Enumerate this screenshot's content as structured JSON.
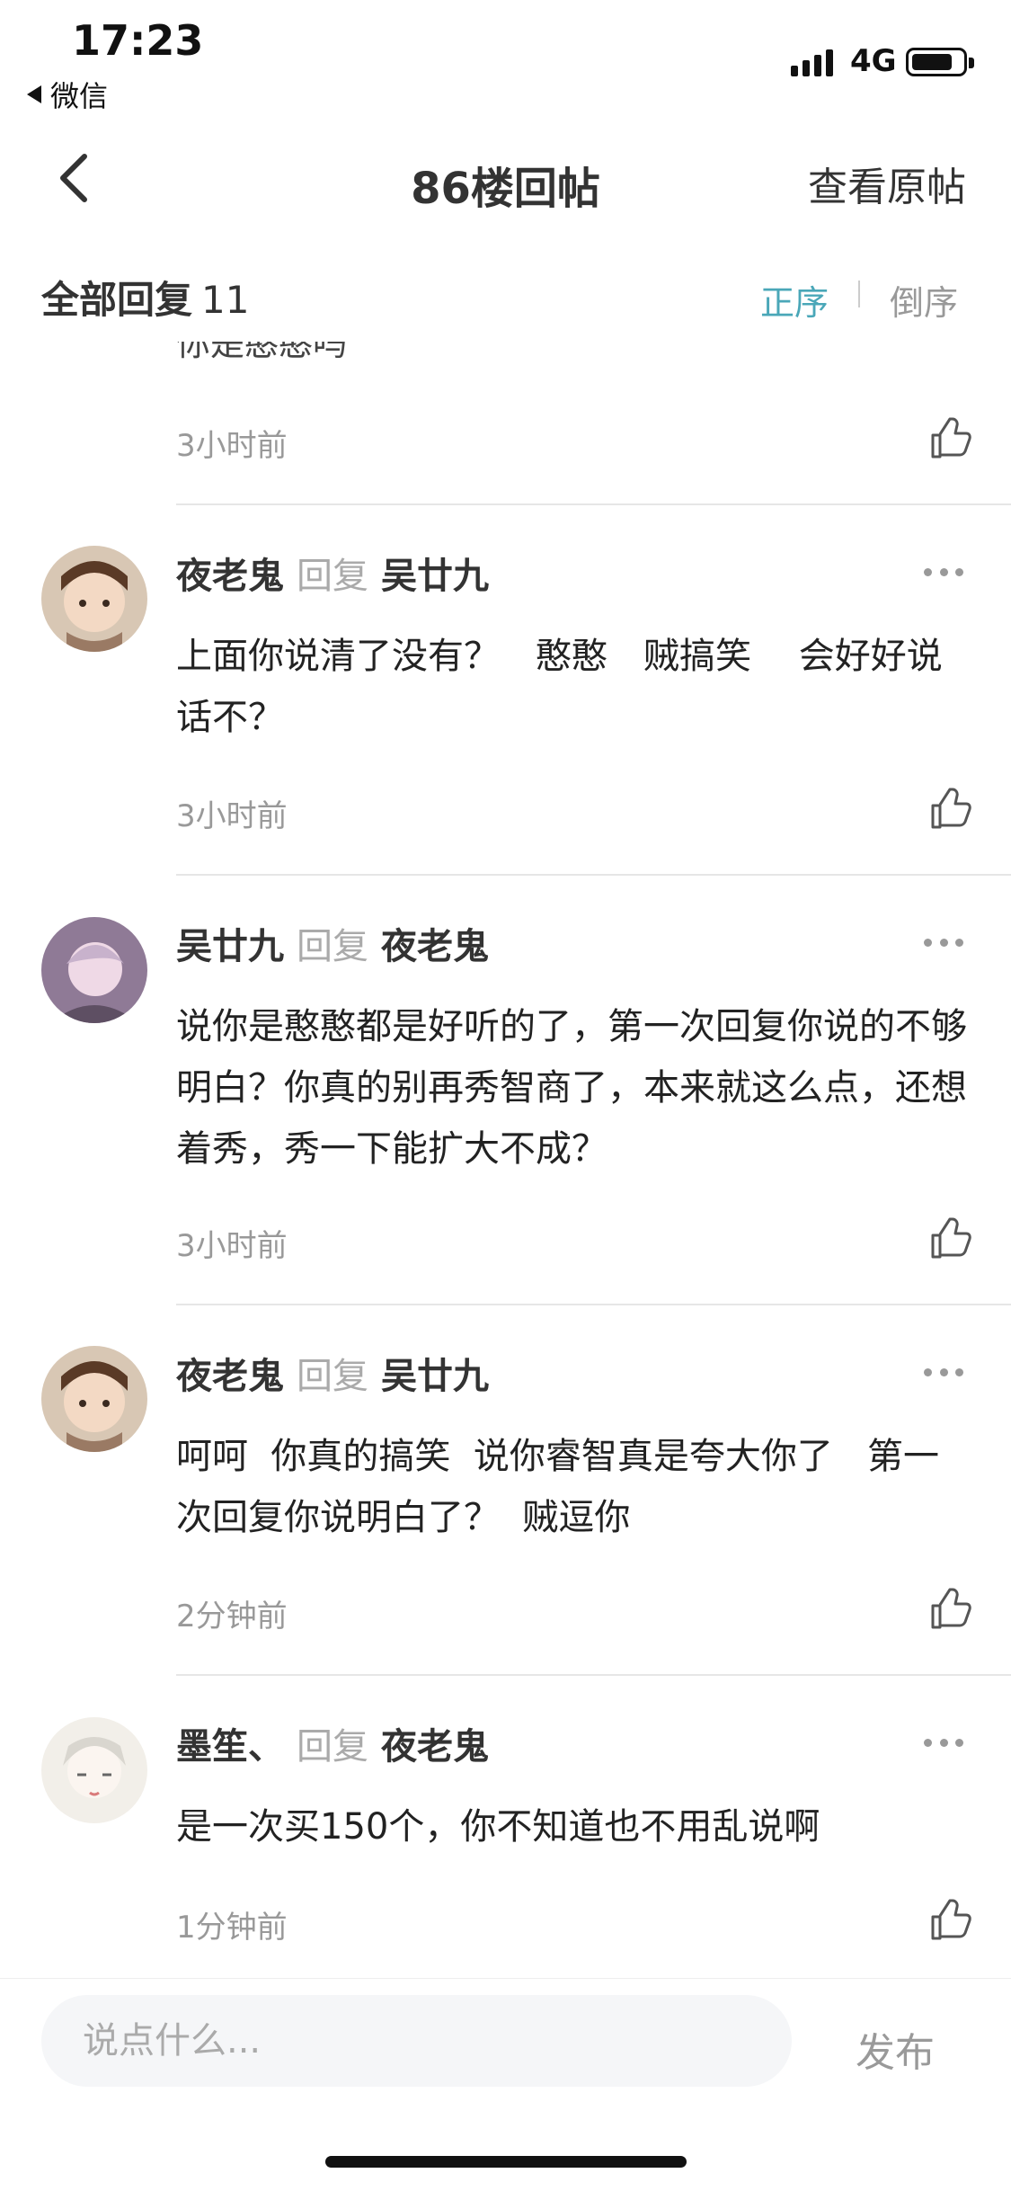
{
  "status_bar": {
    "time": "17:23",
    "back_app": "微信",
    "network": "4G"
  },
  "nav": {
    "title": "86楼回帖",
    "right_action": "查看原帖"
  },
  "reply_header": {
    "label": "全部回复",
    "count": "11",
    "sort_asc": "正序",
    "sort_desc": "倒序",
    "accent_color": "#4aa7b8"
  },
  "partial_top": {
    "text": "你是憨憨吗",
    "time": "3小时前"
  },
  "comments": [
    {
      "author": "夜老鬼",
      "reply_word": "回复",
      "reply_to": "吴廿九",
      "content": "上面你说清了没有？　憨憨　贼搞笑　 会好好说话不？",
      "time": "3小时前"
    },
    {
      "author": "吴廿九",
      "reply_word": "回复",
      "reply_to": "夜老鬼",
      "content": "说你是憨憨都是好听的了，第一次回复你说的不够明白？你真的别再秀智商了，本来就这么点，还想着秀，秀一下能扩大不成？",
      "time": "3小时前"
    },
    {
      "author": "夜老鬼",
      "reply_word": "回复",
      "reply_to": "吴廿九",
      "content": "呵呵  你真的搞笑  说你睿智真是夸大你了   第一次回复你说明白了？  贼逗你",
      "time": "2分钟前"
    },
    {
      "author": "墨笙、",
      "reply_word": "回复",
      "reply_to": "夜老鬼",
      "content": "是一次买150个，你不知道也不用乱说啊",
      "time": "1分钟前"
    }
  ],
  "bottom_bar": {
    "input_placeholder": "说点什么...",
    "publish": "发布"
  }
}
